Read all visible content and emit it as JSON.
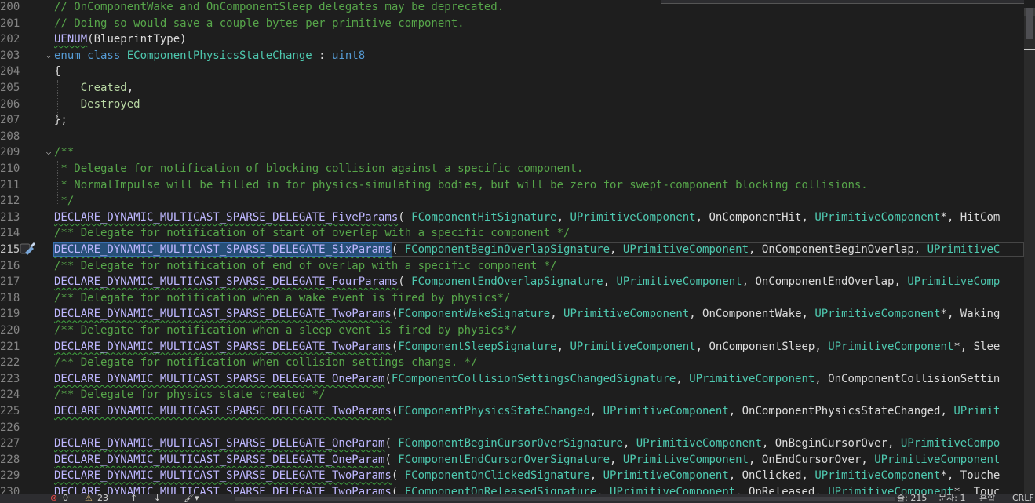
{
  "editor": {
    "current_line": "215",
    "lines": [
      {
        "n": "200",
        "fold": "",
        "tokens": [
          {
            "t": "// OnComponentWake and OnComponentSleep delegates may be deprecated.",
            "c": "com"
          }
        ]
      },
      {
        "n": "201",
        "fold": "",
        "tokens": [
          {
            "t": "// Doing so would save a couple bytes per primitive component.",
            "c": "com"
          }
        ]
      },
      {
        "n": "202",
        "fold": "",
        "tokens": [
          {
            "t": "UENUM",
            "c": "mac"
          },
          {
            "t": "(BlueprintType)",
            "c": "txt"
          }
        ]
      },
      {
        "n": "203",
        "fold": "v",
        "tokens": [
          {
            "t": "enum class ",
            "c": "kw"
          },
          {
            "t": "EComponentPhysicsStateChange",
            "c": "type"
          },
          {
            "t": " : ",
            "c": "txt"
          },
          {
            "t": "uint8",
            "c": "kw"
          }
        ]
      },
      {
        "n": "204",
        "fold": "",
        "tokens": [
          {
            "t": "{",
            "c": "txt"
          }
        ]
      },
      {
        "n": "205",
        "fold": "",
        "tokens": [
          {
            "t": "    ",
            "c": "txt"
          },
          {
            "t": "Created",
            "c": "enum"
          },
          {
            "t": ",",
            "c": "txt"
          }
        ]
      },
      {
        "n": "206",
        "fold": "",
        "tokens": [
          {
            "t": "    ",
            "c": "txt"
          },
          {
            "t": "Destroyed",
            "c": "enum"
          }
        ]
      },
      {
        "n": "207",
        "fold": "",
        "tokens": [
          {
            "t": "};",
            "c": "txt"
          }
        ]
      },
      {
        "n": "208",
        "fold": "",
        "tokens": []
      },
      {
        "n": "209",
        "fold": "v",
        "tokens": [
          {
            "t": "/**",
            "c": "com"
          }
        ]
      },
      {
        "n": "210",
        "fold": "",
        "tokens": [
          {
            "t": " * Delegate for notification of blocking collision against a specific component.",
            "c": "com"
          }
        ]
      },
      {
        "n": "211",
        "fold": "",
        "tokens": [
          {
            "t": " * NormalImpulse will be filled in for physics-simulating bodies, but will be zero for swept-component blocking collisions.",
            "c": "com"
          }
        ]
      },
      {
        "n": "212",
        "fold": "",
        "tokens": [
          {
            "t": " */",
            "c": "com"
          }
        ]
      },
      {
        "n": "213",
        "fold": "",
        "tokens": [
          {
            "t": "DECLARE_DYNAMIC_MULTICAST_SPARSE_DELEGATE_FiveParams",
            "c": "mac"
          },
          {
            "t": "( ",
            "c": "txt"
          },
          {
            "t": "FComponentHitSignature",
            "c": "type"
          },
          {
            "t": ", ",
            "c": "txt"
          },
          {
            "t": "UPrimitiveComponent",
            "c": "type"
          },
          {
            "t": ", OnComponentHit, ",
            "c": "txt"
          },
          {
            "t": "UPrimitiveComponent",
            "c": "type"
          },
          {
            "t": "*, HitCom",
            "c": "txt"
          }
        ]
      },
      {
        "n": "214",
        "fold": "",
        "tokens": [
          {
            "t": "/** Delegate for notification of start of overlap with a specific component */",
            "c": "com"
          }
        ]
      },
      {
        "n": "215",
        "fold": "",
        "sel": true,
        "tokens": [
          {
            "t": "DECLARE_DYNAMIC_MULTICAST_SPARSE_DELEGATE_SixParams",
            "c": "mac",
            "sel": true
          },
          {
            "t": "( ",
            "c": "txt"
          },
          {
            "t": "FComponentBeginOverlapSignature",
            "c": "type"
          },
          {
            "t": ", ",
            "c": "txt"
          },
          {
            "t": "UPrimitiveComponent",
            "c": "type"
          },
          {
            "t": ", OnComponentBeginOverlap, ",
            "c": "txt"
          },
          {
            "t": "UPrimitiveC",
            "c": "type"
          }
        ]
      },
      {
        "n": "216",
        "fold": "",
        "tokens": [
          {
            "t": "/** Delegate for notification of end of overlap with a specific component */",
            "c": "com"
          }
        ]
      },
      {
        "n": "217",
        "fold": "",
        "tokens": [
          {
            "t": "DECLARE_DYNAMIC_MULTICAST_SPARSE_DELEGATE_FourParams",
            "c": "mac"
          },
          {
            "t": "( ",
            "c": "txt"
          },
          {
            "t": "FComponentEndOverlapSignature",
            "c": "type"
          },
          {
            "t": ", ",
            "c": "txt"
          },
          {
            "t": "UPrimitiveComponent",
            "c": "type"
          },
          {
            "t": ", OnComponentEndOverlap, ",
            "c": "txt"
          },
          {
            "t": "UPrimitiveComp",
            "c": "type"
          }
        ]
      },
      {
        "n": "218",
        "fold": "",
        "tokens": [
          {
            "t": "/** Delegate for notification when a wake event is fired by physics*/",
            "c": "com"
          }
        ]
      },
      {
        "n": "219",
        "fold": "",
        "tokens": [
          {
            "t": "DECLARE_DYNAMIC_MULTICAST_SPARSE_DELEGATE_TwoParams",
            "c": "mac"
          },
          {
            "t": "(",
            "c": "txt"
          },
          {
            "t": "FComponentWakeSignature",
            "c": "type"
          },
          {
            "t": ", ",
            "c": "txt"
          },
          {
            "t": "UPrimitiveComponent",
            "c": "type"
          },
          {
            "t": ", OnComponentWake, ",
            "c": "txt"
          },
          {
            "t": "UPrimitiveComponent",
            "c": "type"
          },
          {
            "t": "*, Waking",
            "c": "txt"
          }
        ]
      },
      {
        "n": "220",
        "fold": "",
        "tokens": [
          {
            "t": "/** Delegate for notification when a sleep event is fired by physics*/",
            "c": "com"
          }
        ]
      },
      {
        "n": "221",
        "fold": "",
        "tokens": [
          {
            "t": "DECLARE_DYNAMIC_MULTICAST_SPARSE_DELEGATE_TwoParams",
            "c": "mac"
          },
          {
            "t": "(",
            "c": "txt"
          },
          {
            "t": "FComponentSleepSignature",
            "c": "type"
          },
          {
            "t": ", ",
            "c": "txt"
          },
          {
            "t": "UPrimitiveComponent",
            "c": "type"
          },
          {
            "t": ", OnComponentSleep, ",
            "c": "txt"
          },
          {
            "t": "UPrimitiveComponent",
            "c": "type"
          },
          {
            "t": "*, Slee",
            "c": "txt"
          }
        ]
      },
      {
        "n": "222",
        "fold": "",
        "tokens": [
          {
            "t": "/** Delegate for notification when collision settings change. */",
            "c": "com"
          }
        ]
      },
      {
        "n": "223",
        "fold": "",
        "tokens": [
          {
            "t": "DECLARE_DYNAMIC_MULTICAST_SPARSE_DELEGATE_OneParam",
            "c": "mac"
          },
          {
            "t": "(",
            "c": "txt"
          },
          {
            "t": "FComponentCollisionSettingsChangedSignature",
            "c": "type"
          },
          {
            "t": ", ",
            "c": "txt"
          },
          {
            "t": "UPrimitiveComponent",
            "c": "type"
          },
          {
            "t": ", OnComponentCollisionSettin",
            "c": "txt"
          }
        ]
      },
      {
        "n": "224",
        "fold": "",
        "tokens": [
          {
            "t": "/** Delegate for physics state created */",
            "c": "com"
          }
        ]
      },
      {
        "n": "225",
        "fold": "",
        "tokens": [
          {
            "t": "DECLARE_DYNAMIC_MULTICAST_SPARSE_DELEGATE_TwoParams",
            "c": "mac"
          },
          {
            "t": "(",
            "c": "txt"
          },
          {
            "t": "FComponentPhysicsStateChanged",
            "c": "type"
          },
          {
            "t": ", ",
            "c": "txt"
          },
          {
            "t": "UPrimitiveComponent",
            "c": "type"
          },
          {
            "t": ", OnComponentPhysicsStateChanged, ",
            "c": "txt"
          },
          {
            "t": "UPrimit",
            "c": "type"
          }
        ]
      },
      {
        "n": "226",
        "fold": "",
        "tokens": []
      },
      {
        "n": "227",
        "fold": "",
        "tokens": [
          {
            "t": "DECLARE_DYNAMIC_MULTICAST_SPARSE_DELEGATE_OneParam",
            "c": "mac"
          },
          {
            "t": "( ",
            "c": "txt"
          },
          {
            "t": "FComponentBeginCursorOverSignature",
            "c": "type"
          },
          {
            "t": ", ",
            "c": "txt"
          },
          {
            "t": "UPrimitiveComponent",
            "c": "type"
          },
          {
            "t": ", OnBeginCursorOver, ",
            "c": "txt"
          },
          {
            "t": "UPrimitiveCompo",
            "c": "type"
          }
        ]
      },
      {
        "n": "228",
        "fold": "",
        "tokens": [
          {
            "t": "DECLARE_DYNAMIC_MULTICAST_SPARSE_DELEGATE_OneParam",
            "c": "mac"
          },
          {
            "t": "( ",
            "c": "txt"
          },
          {
            "t": "FComponentEndCursorOverSignature",
            "c": "type"
          },
          {
            "t": ", ",
            "c": "txt"
          },
          {
            "t": "UPrimitiveComponent",
            "c": "type"
          },
          {
            "t": ", OnEndCursorOver, ",
            "c": "txt"
          },
          {
            "t": "UPrimitiveComponent",
            "c": "type"
          }
        ]
      },
      {
        "n": "229",
        "fold": "",
        "tokens": [
          {
            "t": "DECLARE_DYNAMIC_MULTICAST_SPARSE_DELEGATE_TwoParams",
            "c": "mac"
          },
          {
            "t": "( ",
            "c": "txt"
          },
          {
            "t": "FComponentOnClickedSignature",
            "c": "type"
          },
          {
            "t": ", ",
            "c": "txt"
          },
          {
            "t": "UPrimitiveComponent",
            "c": "type"
          },
          {
            "t": ", OnClicked, ",
            "c": "txt"
          },
          {
            "t": "UPrimitiveComponent",
            "c": "type"
          },
          {
            "t": "*, Touche",
            "c": "txt"
          }
        ]
      },
      {
        "n": "230",
        "fold": "",
        "tokens": [
          {
            "t": "DECLARE_DYNAMIC_MULTICAST_SPARSE_DELEGATE_TwoParams",
            "c": "mac"
          },
          {
            "t": "( ",
            "c": "txt"
          },
          {
            "t": "FComponentOnReleasedSignature",
            "c": "type"
          },
          {
            "t": ", ",
            "c": "txt"
          },
          {
            "t": "UPrimitiveComponent",
            "c": "type"
          },
          {
            "t": ", OnReleased, ",
            "c": "txt"
          },
          {
            "t": "UPrimitiveComponent",
            "c": "type"
          },
          {
            "t": "*, Touc",
            "c": "txt"
          }
        ]
      }
    ]
  },
  "status": {
    "errors": "0",
    "warnings": "23",
    "line": "줄: 215",
    "char": "문자: 1",
    "mode": "혼합",
    "eol": "CRLF"
  },
  "icons": {
    "error": "error-icon",
    "warning": "warning-icon",
    "up": "arrow-up-icon",
    "down": "arrow-down-icon",
    "brush": "brush-icon",
    "marker": "screwdriver-icon"
  }
}
